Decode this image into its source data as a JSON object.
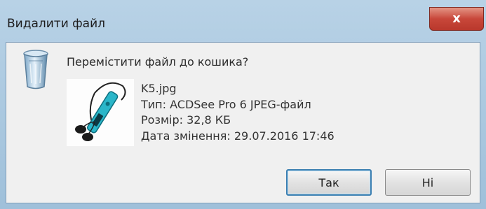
{
  "window": {
    "title": "Видалити файл",
    "close_glyph": "x"
  },
  "dialog": {
    "question": "Перемістити файл до кошика?",
    "icon": "recycle-bin-icon",
    "thumbnail_icon": "mp3-player-thumbnail"
  },
  "file": {
    "name": "K5.jpg",
    "type": "Тип: ACDSee Pro 6 JPEG-файл",
    "size": "Розмір: 32,8 КБ",
    "modified": "Дата змінення: 29.07.2016 17:46"
  },
  "buttons": {
    "yes_label": "Так",
    "no_label": "Ні"
  },
  "colors": {
    "close_button": "#c8473a",
    "default_button_border": "#3c7fb1"
  }
}
